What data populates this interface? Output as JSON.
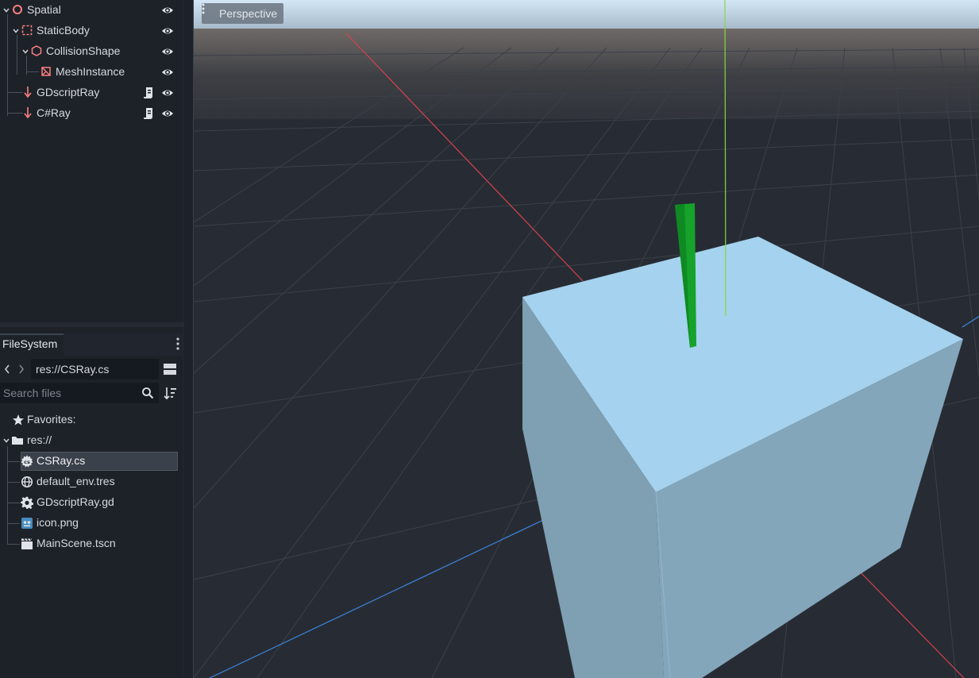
{
  "scene_tree": {
    "nodes": [
      {
        "label": "Spatial",
        "icon": "spatial-node-icon"
      },
      {
        "label": "StaticBody",
        "icon": "static-body-icon"
      },
      {
        "label": "CollisionShape",
        "icon": "collision-shape-icon"
      },
      {
        "label": "MeshInstance",
        "icon": "mesh-instance-icon"
      },
      {
        "label": "GDscriptRay",
        "icon": "raycast-icon",
        "script": "script-icon"
      },
      {
        "label": "C#Ray",
        "icon": "raycast-icon",
        "script": "script-icon"
      }
    ]
  },
  "filesystem": {
    "tab_label": "FileSystem",
    "path": "res://CSRay.cs",
    "search_placeholder": "Search files",
    "favorites_label": "Favorites:",
    "root_label": "res://",
    "files": [
      {
        "label": "CSRay.cs",
        "icon": "csharp-file-icon",
        "selected": true
      },
      {
        "label": "default_env.tres",
        "icon": "environment-icon"
      },
      {
        "label": "GDscriptRay.gd",
        "icon": "gear-icon"
      },
      {
        "label": "icon.png",
        "icon": "image-icon"
      },
      {
        "label": "MainScene.tscn",
        "icon": "scene-icon"
      }
    ]
  },
  "viewport": {
    "view_label": "Perspective",
    "colors": {
      "sky": "#c9def0",
      "ground": "#272c34",
      "grid": "#3c424b",
      "x_axis": "#d8414c",
      "y_axis": "#8ad53c",
      "z_axis": "#3c86e0",
      "box_top": "#a5d2ee",
      "box_side": "#7f9fb2",
      "box_front": "#84a6bb",
      "ray": "#16a22b"
    }
  }
}
